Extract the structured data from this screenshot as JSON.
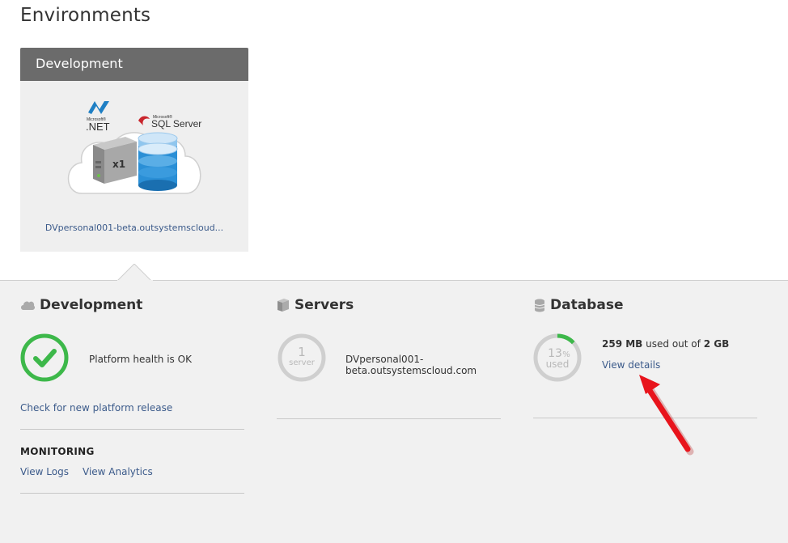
{
  "page": {
    "title": "Environments"
  },
  "environment_card": {
    "title": "Development",
    "illustration": {
      "dotnet_logo_text": ".NET",
      "dotnet_logo_brand": "Microsoft®",
      "sql_logo_text": "SQL Server",
      "sql_logo_brand": "Microsoft®",
      "server_count_label": "x1"
    },
    "link": "DVpersonal001-beta.outsystemscloud..."
  },
  "development": {
    "title": "Development",
    "icon": "cloud-icon",
    "health_status": "Platform health is OK",
    "check_release_link": "Check for new platform release",
    "monitoring_title": "MONITORING",
    "view_logs_link": "View Logs",
    "view_analytics_link": "View Analytics"
  },
  "servers": {
    "title": "Servers",
    "icon": "server-icon",
    "count": "1",
    "count_label": "server",
    "host_line1": "DVpersonal001-",
    "host_line2": "beta.outsystemscloud.com"
  },
  "database": {
    "title": "Database",
    "icon": "database-icon",
    "usage_percent": "13",
    "usage_percent_sign": "%",
    "usage_label": "used",
    "usage_fraction": 0.13,
    "used_amount": "259 MB",
    "used_text": "used out of",
    "total_amount": "2 GB",
    "view_details_link": "View details"
  },
  "colors": {
    "accent_green": "#3db84a",
    "link_blue": "#3b5a8a",
    "arrow_red": "#e8141c",
    "header_gray": "#6b6b6b"
  }
}
